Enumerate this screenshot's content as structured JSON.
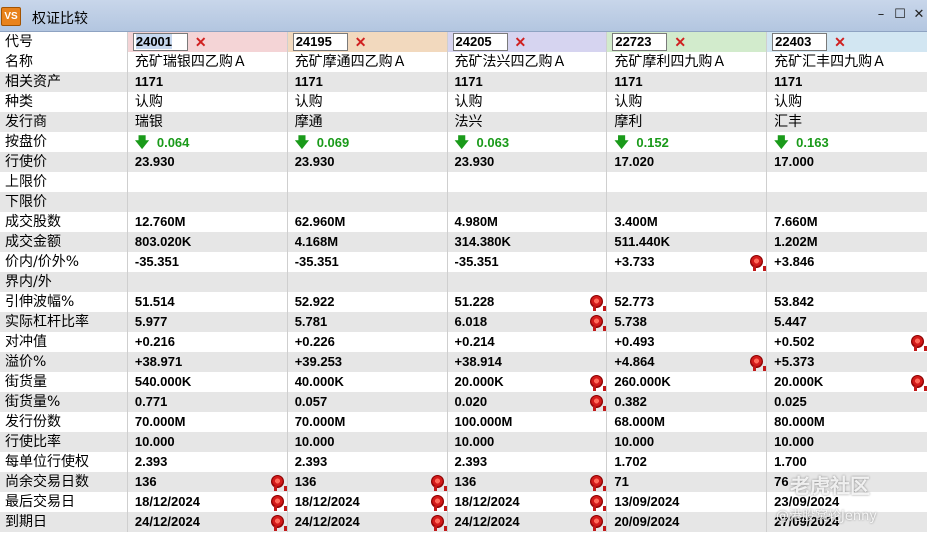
{
  "window": {
    "icon_text": "VS",
    "title": "权证比较",
    "controls": [
      "–",
      "☐",
      "✕"
    ]
  },
  "labels": {
    "code": "代号",
    "name": "名称",
    "underlying": "相关资产",
    "type": "种类",
    "issuer": "发行商",
    "bid": "按盘价",
    "strike": "行使价",
    "upper": "上限价",
    "lower": "下限价",
    "volume": "成交股数",
    "turnover": "成交金额",
    "moneyness": "价内/价外%",
    "inout": "界内/外",
    "iv": "引伸波幅%",
    "leverage": "实际杠杆比率",
    "delta": "对冲值",
    "premium": "溢价%",
    "outstanding": "街货量",
    "outstanding_pct": "街货量%",
    "issue_size": "发行份数",
    "ratio": "行使比率",
    "entitlement": "每单位行使权",
    "days_left": "尚余交易日数",
    "last_trade": "最后交易日",
    "expiry": "到期日"
  },
  "delete_icon": "✕",
  "columns": [
    {
      "code": "24001",
      "code_color": "#f4d4d6",
      "name": "充矿瑞银四乙购Ａ",
      "underlying": "1171",
      "type": "认购",
      "issuer": "瑞银",
      "bid": "0.064",
      "strike": "23.930",
      "upper": "",
      "lower": "",
      "volume": "12.760M",
      "turnover": "803.020K",
      "moneyness": "-35.351",
      "inout": "",
      "iv": "51.514",
      "leverage": "5.977",
      "delta": "+0.216",
      "premium": "+38.971",
      "outstanding": "540.000K",
      "outstanding_pct": "0.771",
      "issue_size": "70.000M",
      "ratio": "10.000",
      "entitlement": "2.393",
      "days_left": "136",
      "last_trade": "18/12/2024",
      "expiry": "24/12/2024",
      "badges": [
        "days_left",
        "last_trade",
        "expiry"
      ]
    },
    {
      "code": "24195",
      "code_color": "#f2d9be",
      "name": "充矿摩通四乙购Ａ",
      "underlying": "1171",
      "type": "认购",
      "issuer": "摩通",
      "bid": "0.069",
      "strike": "23.930",
      "upper": "",
      "lower": "",
      "volume": "62.960M",
      "turnover": "4.168M",
      "moneyness": "-35.351",
      "inout": "",
      "iv": "52.922",
      "leverage": "5.781",
      "delta": "+0.226",
      "premium": "+39.253",
      "outstanding": "40.000K",
      "outstanding_pct": "0.057",
      "issue_size": "70.000M",
      "ratio": "10.000",
      "entitlement": "2.393",
      "days_left": "136",
      "last_trade": "18/12/2024",
      "expiry": "24/12/2024",
      "badges": [
        "days_left",
        "last_trade",
        "expiry"
      ]
    },
    {
      "code": "24205",
      "code_color": "#d6d4f0",
      "name": "充矿法兴四乙购Ａ",
      "underlying": "1171",
      "type": "认购",
      "issuer": "法兴",
      "bid": "0.063",
      "strike": "23.930",
      "upper": "",
      "lower": "",
      "volume": "4.980M",
      "turnover": "314.380K",
      "moneyness": "-35.351",
      "inout": "",
      "iv": "51.228",
      "leverage": "6.018",
      "delta": "+0.214",
      "premium": "+38.914",
      "outstanding": "20.000K",
      "outstanding_pct": "0.020",
      "issue_size": "100.000M",
      "ratio": "10.000",
      "entitlement": "2.393",
      "days_left": "136",
      "last_trade": "18/12/2024",
      "expiry": "24/12/2024",
      "badges": [
        "iv",
        "leverage",
        "outstanding",
        "outstanding_pct",
        "days_left",
        "last_trade",
        "expiry"
      ]
    },
    {
      "code": "22723",
      "code_color": "#d2ebcc",
      "name": "充矿摩利四九购Ａ",
      "underlying": "1171",
      "type": "认购",
      "issuer": "摩利",
      "bid": "0.152",
      "strike": "17.020",
      "upper": "",
      "lower": "",
      "volume": "3.400M",
      "turnover": "511.440K",
      "moneyness": "+3.733",
      "inout": "",
      "iv": "52.773",
      "leverage": "5.738",
      "delta": "+0.493",
      "premium": "+4.864",
      "outstanding": "260.000K",
      "outstanding_pct": "0.382",
      "issue_size": "68.000M",
      "ratio": "10.000",
      "entitlement": "1.702",
      "days_left": "71",
      "last_trade": "13/09/2024",
      "expiry": "20/09/2024",
      "badges": [
        "moneyness",
        "premium"
      ]
    },
    {
      "code": "22403",
      "code_color": "#d2e6f2",
      "name": "充矿汇丰四九购Ａ",
      "underlying": "1171",
      "type": "认购",
      "issuer": "汇丰",
      "bid": "0.163",
      "strike": "17.000",
      "upper": "",
      "lower": "",
      "volume": "7.660M",
      "turnover": "1.202M",
      "moneyness": "+3.846",
      "inout": "",
      "iv": "53.842",
      "leverage": "5.447",
      "delta": "+0.502",
      "premium": "+5.373",
      "outstanding": "20.000K",
      "outstanding_pct": "0.025",
      "issue_size": "80.000M",
      "ratio": "10.000",
      "entitlement": "1.700",
      "days_left": "76",
      "last_trade": "23/09/2024",
      "expiry": "27/09/2024",
      "badges": [
        "delta",
        "outstanding"
      ]
    }
  ],
  "watermark": {
    "line1": "老虎社区",
    "line2": "@港股窝轮Jenny"
  }
}
